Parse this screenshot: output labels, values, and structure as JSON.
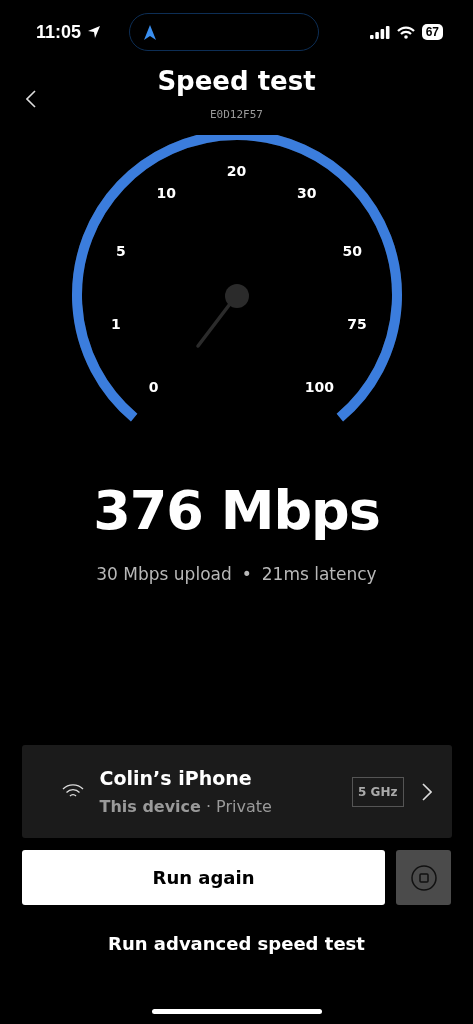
{
  "status_bar": {
    "time": "11:05",
    "battery": "67"
  },
  "header": {
    "title": "Speed test",
    "subtitle": "E0D12F57"
  },
  "gauge": {
    "ticks": [
      "0",
      "1",
      "5",
      "10",
      "20",
      "30",
      "50",
      "75",
      "100"
    ]
  },
  "result": {
    "speed": "376 Mbps",
    "upload": "30 Mbps upload",
    "separator": "•",
    "latency": "21ms latency"
  },
  "device": {
    "name": "Colin’s iPhone",
    "kind_label": "This device",
    "separator": "·",
    "network": "Private",
    "band": "5 GHz"
  },
  "buttons": {
    "primary": "Run again",
    "link": "Run advanced speed test"
  }
}
